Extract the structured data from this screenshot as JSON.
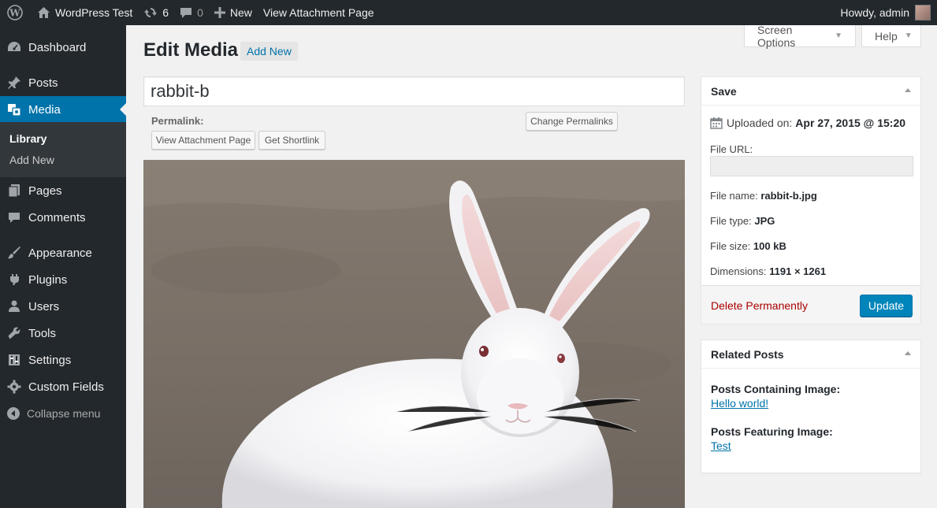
{
  "admin_bar": {
    "site_name": "WordPress Test",
    "updates_count": "6",
    "comments_count": "0",
    "new_label": "New",
    "view_label": "View Attachment Page",
    "greeting": "Howdy, admin"
  },
  "sidebar": {
    "items": [
      {
        "label": "Dashboard",
        "icon": "dashboard-icon"
      },
      {
        "label": "Posts",
        "icon": "pin-icon"
      },
      {
        "label": "Media",
        "icon": "media-icon"
      },
      {
        "label": "Pages",
        "icon": "page-icon"
      },
      {
        "label": "Comments",
        "icon": "comment-icon"
      },
      {
        "label": "Appearance",
        "icon": "brush-icon"
      },
      {
        "label": "Plugins",
        "icon": "plugin-icon"
      },
      {
        "label": "Users",
        "icon": "user-icon"
      },
      {
        "label": "Tools",
        "icon": "wrench-icon"
      },
      {
        "label": "Settings",
        "icon": "settings-icon"
      },
      {
        "label": "Custom Fields",
        "icon": "gear-icon"
      }
    ],
    "submenu": [
      "Library",
      "Add New"
    ],
    "collapse_label": "Collapse menu"
  },
  "screen_meta": {
    "screen_options": "Screen Options",
    "help": "Help"
  },
  "page": {
    "title": "Edit Media",
    "add_new": "Add New",
    "media_title": "rabbit-b",
    "permalink_label": "Permalink:",
    "view_attachment_btn": "View Attachment Page",
    "get_shortlink_btn": "Get Shortlink",
    "change_permalinks_btn": "Change Permalinks"
  },
  "save_box": {
    "title": "Save",
    "uploaded_label": "Uploaded on:",
    "uploaded_value": "Apr 27, 2015 @ 15:20",
    "file_url_label": "File URL:",
    "file_name_label": "File name:",
    "file_name_value": "rabbit-b.jpg",
    "file_type_label": "File type:",
    "file_type_value": "JPG",
    "file_size_label": "File size:",
    "file_size_value": "100 kB",
    "dimensions_label": "Dimensions:",
    "dimensions_value": "1191 × 1261",
    "delete_label": "Delete Permanently",
    "update_label": "Update"
  },
  "related_box": {
    "title": "Related Posts",
    "containing_label": "Posts Containing Image:",
    "containing_link": "Hello world!",
    "featuring_label": "Posts Featuring Image:",
    "featuring_link": "Test"
  },
  "colors": {
    "admin_bar_bg": "#23282d",
    "active_menu": "#0073aa",
    "link": "#0073aa",
    "delete": "#aa0000",
    "primary_button": "#0085ba"
  }
}
